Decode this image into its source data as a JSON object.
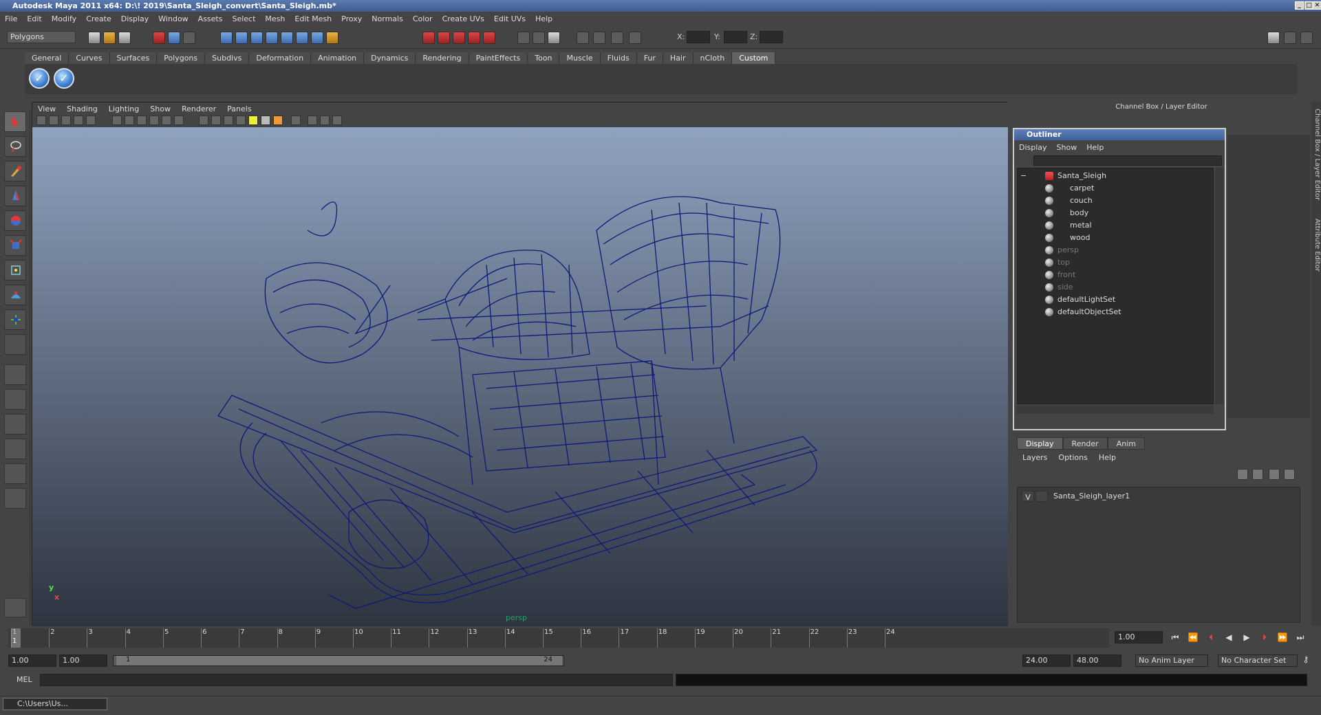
{
  "title": "Autodesk Maya 2011 x64: D:\\! 2019\\Santa_Sleigh_convert\\Santa_Sleigh.mb*",
  "window_buttons": {
    "minimize": "_",
    "maximize": "□",
    "close": "✕"
  },
  "menu": [
    "File",
    "Edit",
    "Modify",
    "Create",
    "Display",
    "Window",
    "Assets",
    "Select",
    "Mesh",
    "Edit Mesh",
    "Proxy",
    "Normals",
    "Color",
    "Create UVs",
    "Edit UVs",
    "Help"
  ],
  "status_line": {
    "mode": "Polygons",
    "x_label": "X:",
    "y_label": "Y:",
    "z_label": "Z:"
  },
  "shelf_tabs": [
    "General",
    "Curves",
    "Surfaces",
    "Polygons",
    "Subdivs",
    "Deformation",
    "Animation",
    "Dynamics",
    "Rendering",
    "PaintEffects",
    "Toon",
    "Muscle",
    "Fluids",
    "Fur",
    "Hair",
    "nCloth",
    "Custom"
  ],
  "shelf_active": "Custom",
  "viewport": {
    "menu": [
      "View",
      "Shading",
      "Lighting",
      "Show",
      "Renderer",
      "Panels"
    ],
    "camera_label": "persp",
    "axis_y": "y",
    "axis_x": "x",
    "colors": {
      "wire": "#0b1a78",
      "bg_top": "#8fa2bf",
      "bg_bottom": "#2e3440"
    }
  },
  "channel_box_title": "Channel Box / Layer Editor",
  "outliner": {
    "title": "Outliner",
    "menu": [
      "Display",
      "Show",
      "Help"
    ],
    "expand_toggle": "−",
    "items": [
      {
        "label": "Santa_Sleigh",
        "dim": false
      },
      {
        "label": "carpet",
        "dim": false
      },
      {
        "label": "couch",
        "dim": false
      },
      {
        "label": "body",
        "dim": false
      },
      {
        "label": "metal",
        "dim": false
      },
      {
        "label": "wood",
        "dim": false
      },
      {
        "label": "persp",
        "dim": true
      },
      {
        "label": "top",
        "dim": true
      },
      {
        "label": "front",
        "dim": true
      },
      {
        "label": "side",
        "dim": true
      },
      {
        "label": "defaultLightSet",
        "dim": false
      },
      {
        "label": "defaultObjectSet",
        "dim": false
      }
    ]
  },
  "layer_editor": {
    "tabs": [
      "Display",
      "Render",
      "Anim"
    ],
    "active_tab": "Display",
    "menu": [
      "Layers",
      "Options",
      "Help"
    ],
    "layer": {
      "visible": "V",
      "name": "Santa_Sleigh_layer1"
    }
  },
  "side_tabs": [
    "Channel Box / Layer Editor",
    "Attribute Editor"
  ],
  "time_slider": {
    "ticks": [
      "1",
      "2",
      "3",
      "4",
      "5",
      "6",
      "7",
      "8",
      "9",
      "10",
      "11",
      "12",
      "13",
      "14",
      "15",
      "16",
      "17",
      "18",
      "19",
      "20",
      "21",
      "22",
      "23",
      "24"
    ],
    "current_frame": "1.00",
    "current_marker": "1"
  },
  "range": {
    "start": "1.00",
    "playback_start": "1.00",
    "slider_start": "1",
    "slider_end": "24",
    "playback_end": "24.00",
    "end": "48.00",
    "anim_layer": "No Anim Layer",
    "character_set": "No Character Set"
  },
  "mel": {
    "label": "MEL"
  },
  "taskbar": {
    "item": "C:\\Users\\Us..."
  }
}
